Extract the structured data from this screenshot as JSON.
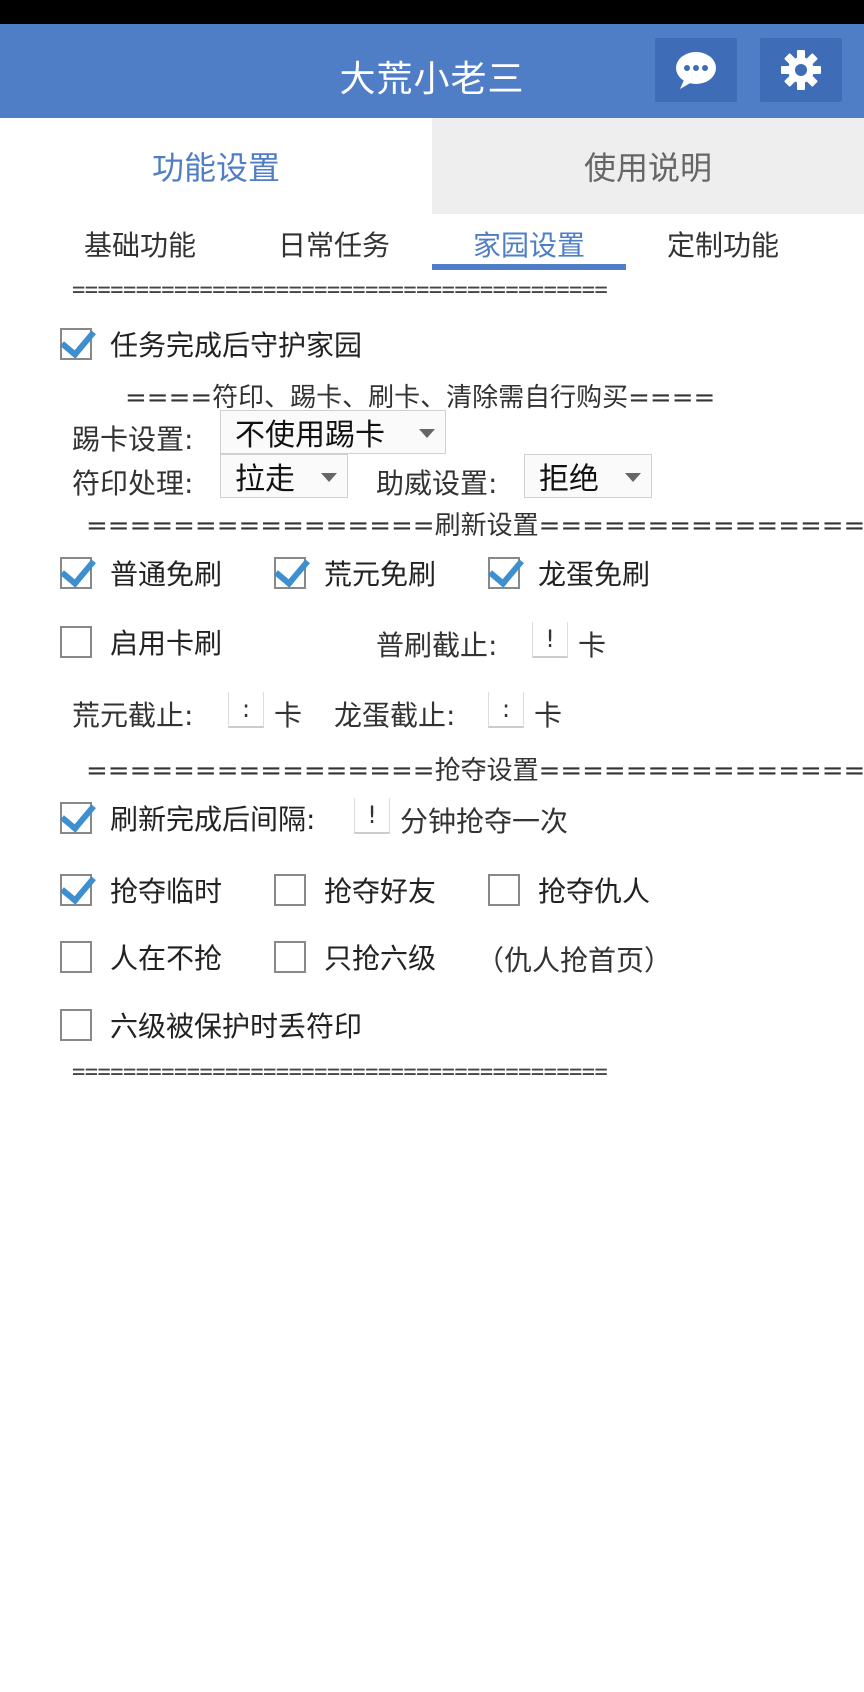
{
  "app": {
    "title": "大荒小老三",
    "chat_icon": "chat-bubble-icon",
    "settings_icon": "gear-icon",
    "accent": "#4f7ec7"
  },
  "main_tabs": [
    {
      "label": "功能设置",
      "active": true
    },
    {
      "label": "使用说明",
      "active": false
    }
  ],
  "sub_tabs": [
    {
      "label": "基础功能",
      "active": false
    },
    {
      "label": "日常任务",
      "active": false
    },
    {
      "label": "家园设置",
      "active": true
    },
    {
      "label": "定制功能",
      "active": false
    }
  ],
  "separator": "==========================================",
  "guard_home": {
    "label": "任务完成后守护家园",
    "checked": true
  },
  "note_buy": "====符印、踢卡、刷卡、清除需自行购买====",
  "kick": {
    "label": "踢卡设置:",
    "value": "不使用踢卡"
  },
  "talisman": {
    "label": "符印处理:",
    "value": "拉走"
  },
  "cheer": {
    "label": "助威设置:",
    "value": "拒绝"
  },
  "refresh_section": "================刷新设置================",
  "refresh_options": [
    {
      "label": "普通免刷",
      "checked": true
    },
    {
      "label": "荒元免刷",
      "checked": true
    },
    {
      "label": "龙蛋免刷",
      "checked": true
    }
  ],
  "card_refresh": {
    "label": "启用卡刷",
    "checked": false
  },
  "normal_stop": {
    "label": "普刷截止:",
    "value": "!",
    "unit": "卡"
  },
  "huangyuan_stop": {
    "label": "荒元截止:",
    "value": ":",
    "unit": "卡"
  },
  "dragon_stop": {
    "label": "龙蛋截止:",
    "value": ":",
    "unit": "卡"
  },
  "plunder_section": "================抢夺设置================",
  "plunder_interval": {
    "label": "刷新完成后间隔:",
    "value": "!",
    "unit": "分钟抢夺一次",
    "checked": true
  },
  "plunder_options": [
    {
      "label": "抢夺临时",
      "checked": true
    },
    {
      "label": "抢夺好友",
      "checked": false
    },
    {
      "label": "抢夺仇人",
      "checked": false
    }
  ],
  "presence_options": [
    {
      "label": "人在不抢",
      "checked": false
    },
    {
      "label": "只抢六级",
      "checked": false
    }
  ],
  "enemy_note": "（仇人抢首页）",
  "drop_talisman": {
    "label": "六级被保护时丢符印",
    "checked": false
  }
}
